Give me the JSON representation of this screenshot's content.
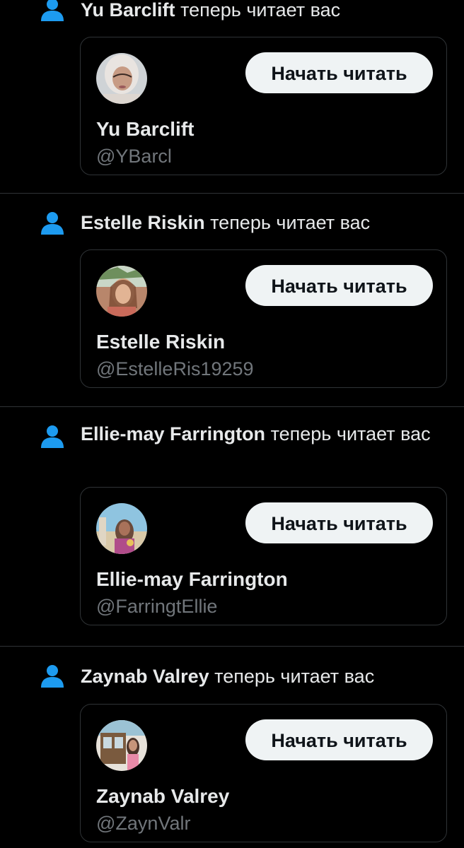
{
  "action_text": "теперь читает вас",
  "follow_label": "Начать читать",
  "icon": "person-icon",
  "colors": {
    "background": "#000000",
    "accent": "#1d9bf0",
    "text": "#e7e9ea",
    "muted": "#71767b",
    "button_bg": "#eff3f4"
  },
  "notifications": [
    {
      "name": "Yu Barclift",
      "handle": "@YBarcl"
    },
    {
      "name": "Estelle Riskin",
      "handle": "@EstelleRis19259"
    },
    {
      "name": "Ellie-may Farrington",
      "handle": "@FarringtEllie"
    },
    {
      "name": "Zaynab Valrey",
      "handle": "@ZaynValr"
    }
  ]
}
